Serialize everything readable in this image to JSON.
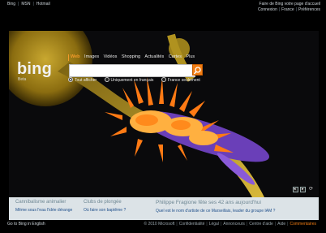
{
  "top_links_left": [
    "Bing",
    "MSN",
    "Hotmail"
  ],
  "top_links_right": {
    "line1": "Faire de Bing votre page d'accueil",
    "connexion": "Connexion",
    "country": "France",
    "preferences": "Préférences"
  },
  "logo": {
    "text": "bing",
    "sub": "Beta"
  },
  "nav_tabs": [
    "Web",
    "Images",
    "Vidéos",
    "Shopping",
    "Actualités",
    "Cartes",
    "Plus"
  ],
  "search": {
    "value": "",
    "placeholder": ""
  },
  "radios": [
    {
      "label": "Tout afficher",
      "selected": true
    },
    {
      "label": "Uniquement en français",
      "selected": false
    },
    {
      "label": "France seulement",
      "selected": false
    }
  ],
  "hero_controls": {
    "prev": "◂",
    "next": "▸",
    "play": "⟳"
  },
  "info": [
    {
      "title": "Cannibalisme animalier",
      "sub": "Même sous l'eau l'idée dérange"
    },
    {
      "title": "Clubs de plongée",
      "sub": "Où faire son baptême ?"
    },
    {
      "title": "Philippe Fragione fête ses 42 ans aujourd'hui",
      "sub": "Quel est le nom d'artiste de ce Marseillais, leader du groupe IAM ?"
    }
  ],
  "footer": {
    "left": "Go to Bing in English",
    "right": [
      "© 2010 Microsoft",
      "Confidentialité",
      "Légal",
      "Annonceurs",
      "Centre d'aide",
      "Aide",
      "Commentaires"
    ]
  },
  "colors": {
    "accent": "#f27d12",
    "info_bg": "#dce3e7",
    "link_blue": "#1f4f8b"
  }
}
